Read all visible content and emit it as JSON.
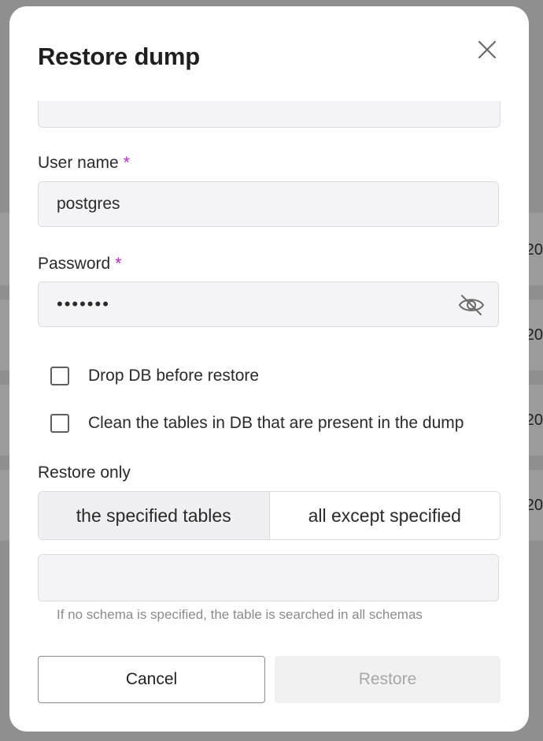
{
  "background": {
    "row_values": [
      "20",
      "20",
      "20",
      "20"
    ]
  },
  "modal": {
    "title": "Restore dump",
    "close_icon": "close-icon",
    "user_name": {
      "label": "User name",
      "required_mark": "*",
      "value": "postgres"
    },
    "password": {
      "label": "Password",
      "required_mark": "*",
      "value": "•••••••",
      "toggle_icon": "eye-off-icon"
    },
    "options": {
      "drop_db": {
        "label": "Drop DB before restore",
        "checked": false
      },
      "clean_tables": {
        "label": "Clean the tables in DB that are present in the dump",
        "checked": false
      }
    },
    "restore_only": {
      "label": "Restore only",
      "options": [
        "the specified tables",
        "all except specified"
      ],
      "selected": "the specified tables",
      "tables_value": "",
      "hint": "If no schema is specified, the table is searched in all schemas"
    },
    "buttons": {
      "cancel": "Cancel",
      "restore": "Restore"
    }
  },
  "colors": {
    "accent_required": "#c021d6",
    "input_bg": "#f4f3f5",
    "disabled_text": "#a7a7a9"
  }
}
